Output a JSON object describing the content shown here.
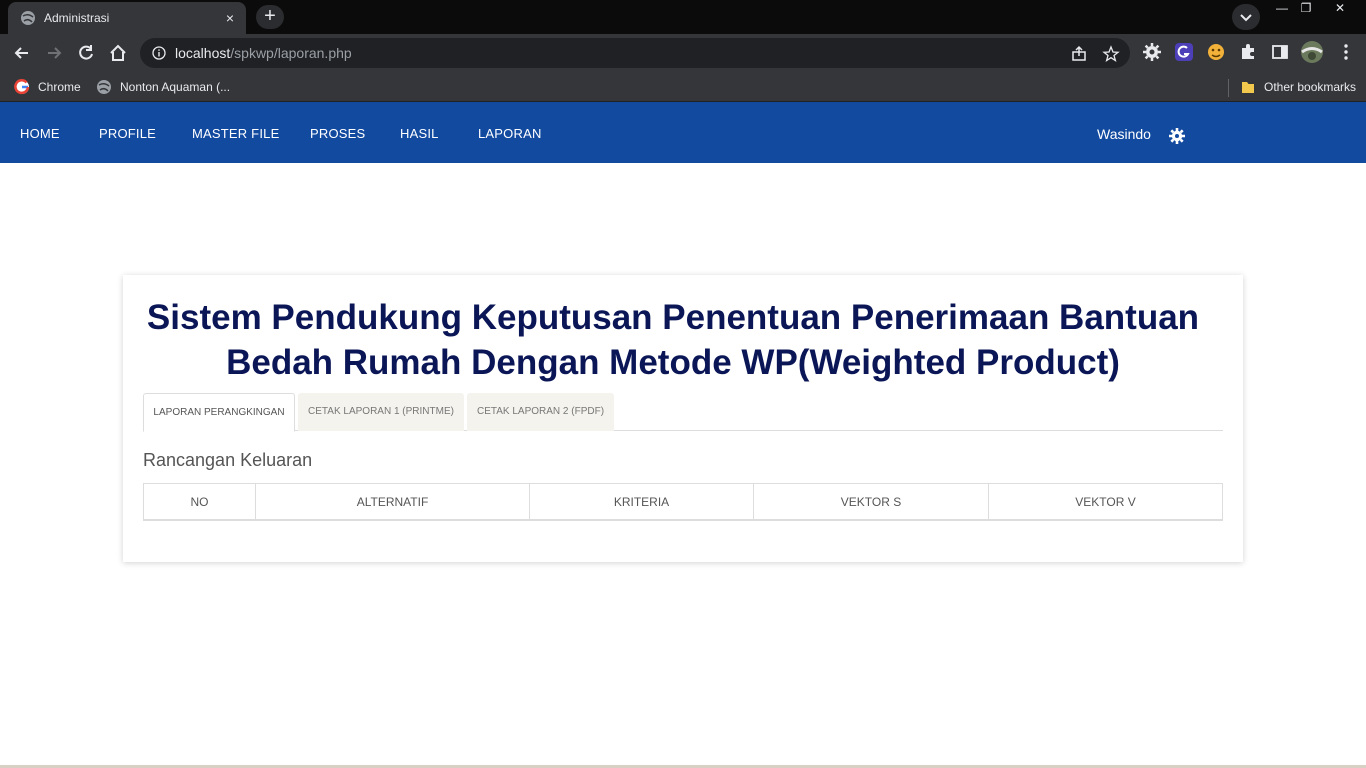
{
  "browser": {
    "tab_title": "Administrasi",
    "tab_close": "×",
    "new_tab": "+",
    "url_host": "localhost",
    "url_path": "/spkwp/laporan.php",
    "bookmarks": [
      "Chrome",
      "Nonton Aquaman (..."
    ],
    "other_bookmarks": "Other bookmarks",
    "window_controls": [
      "—",
      "❐",
      "✕"
    ]
  },
  "nav": {
    "items": [
      "HOME",
      "PROFILE",
      "MASTER FILE",
      "PROSES",
      "HASIL",
      "LAPORAN"
    ],
    "user": "Wasindo"
  },
  "content": {
    "title": "Sistem Pendukung Keputusan Penentuan Penerimaan Bantuan Bedah Rumah Dengan Metode WP(Weighted Product)",
    "tabs": [
      "LAPORAN PERANGKINGAN",
      "CETAK LAPORAN 1 (PRINTME)",
      "CETAK LAPORAN 2 (FPDF)"
    ],
    "active_tab": "LAPORAN PERANGKINGAN",
    "section_title": "Rancangan Keluaran",
    "table_headers": [
      "NO",
      "ALTERNATIF",
      "KRITERIA",
      "VEKTOR S",
      "VEKTOR V"
    ]
  },
  "colors": {
    "nav_bg": "#124aa0",
    "title": "#0b1657",
    "browser_dark": "#35363a"
  },
  "icons": [
    "globe-icon",
    "close-icon",
    "plus-icon",
    "chevron-down-icon",
    "back-icon",
    "forward-icon",
    "reload-icon",
    "home-icon",
    "info-icon",
    "share-icon",
    "star-icon",
    "gear-icon",
    "puzzle-icon",
    "sidebar-icon",
    "avatar",
    "menu-dots-icon",
    "google-icon",
    "folder-icon"
  ]
}
